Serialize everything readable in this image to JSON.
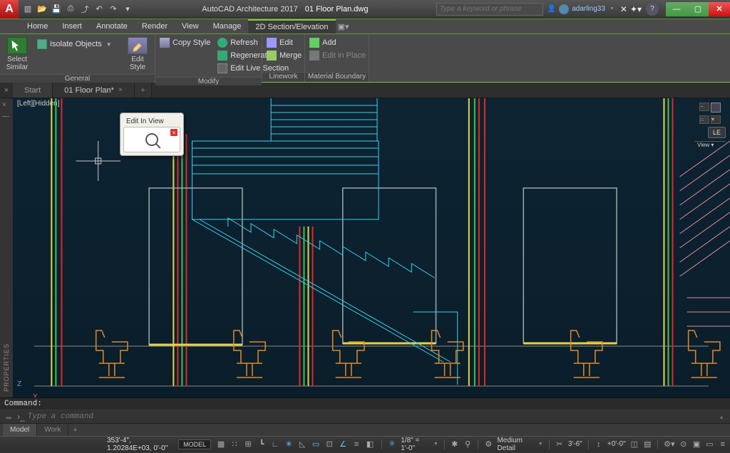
{
  "title": {
    "app": "AutoCAD Architecture 2017",
    "doc": "01 Floor Plan.dwg"
  },
  "search": {
    "placeholder": "Type a keyword or phrase"
  },
  "user": {
    "name": "adarling33"
  },
  "menu": {
    "items": [
      "Home",
      "Insert",
      "Annotate",
      "Render",
      "View",
      "Manage",
      "2D Section/Elevation"
    ],
    "active_index": 6
  },
  "ribbon": {
    "panels": [
      {
        "label": "General",
        "big": [
          {
            "label": "Select\nSimilar"
          },
          {
            "label": "Edit\nStyle"
          }
        ],
        "small": [
          {
            "label": "Isolate Objects"
          }
        ]
      },
      {
        "label": "Modify",
        "rows": [
          {
            "label": "Copy Style"
          },
          {
            "label": "Refresh"
          },
          {
            "label": "Regenerate"
          },
          {
            "label": "Edit Live Section"
          }
        ]
      },
      {
        "label": "Linework",
        "rows": [
          {
            "label": "Edit"
          },
          {
            "label": "Merge"
          }
        ]
      },
      {
        "label": "Material Boundary",
        "rows": [
          {
            "label": "Add"
          },
          {
            "label": "Edit in Place"
          }
        ]
      }
    ]
  },
  "filetabs": {
    "start": "Start",
    "doc": "01 Floor Plan*"
  },
  "canvas": {
    "view_label": "[Left][Hidden]",
    "tooltip": "Edit In View",
    "ucs": {
      "z": "Z",
      "x": "X"
    },
    "nav": {
      "view": "View",
      "left": "LE"
    },
    "properties_label": "PROPERTIES"
  },
  "command": {
    "history": "Command:",
    "placeholder": "Type a command"
  },
  "layout_tabs": {
    "model": "Model",
    "work": "Work"
  },
  "status": {
    "coords": "353'-4\", 1.20284E+03, 0'-0\"",
    "space": "MODEL",
    "scale": "1/8\" = 1'-0\"",
    "detail": "Medium Detail",
    "cut": "3'-6\"",
    "disp_cfg": "+0'-0\"",
    "gear": "⚙"
  }
}
